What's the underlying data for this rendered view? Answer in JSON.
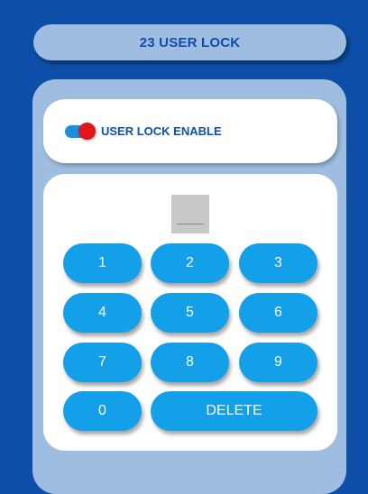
{
  "header": {
    "title": "23 USER LOCK"
  },
  "lock": {
    "enable_label": "USER LOCK ENABLE",
    "enabled": true
  },
  "keypad": {
    "k1": "1",
    "k2": "2",
    "k3": "3",
    "k4": "4",
    "k5": "5",
    "k6": "6",
    "k7": "7",
    "k8": "8",
    "k9": "9",
    "k0": "0",
    "delete": "DELETE"
  },
  "colors": {
    "background": "#0d4ea8",
    "panel": "#9fbde0",
    "key": "#14a0e8",
    "toggle_on": "#e0161b"
  }
}
